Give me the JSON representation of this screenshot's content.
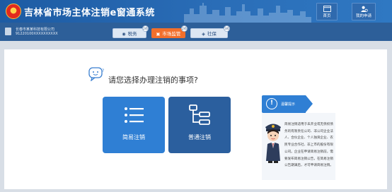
{
  "header": {
    "title": "吉林省市场主体注销e窗通系统",
    "buttons": [
      {
        "label": "首页",
        "icon": "home-icon"
      },
      {
        "label": "我的申请",
        "icon": "my-application-icon"
      }
    ]
  },
  "subbar": {
    "user_line1": "长春市某某科技有限公司",
    "user_line2": "91220100XXXXXXXXXX",
    "tabs": [
      {
        "label": "税务",
        "badge": "2/6",
        "icon": "tax-icon"
      },
      {
        "label": "市场监管",
        "badge": "2/6",
        "icon": "market-icon",
        "active": true
      },
      {
        "label": "社保",
        "badge": "3/6",
        "icon": "social-security-icon"
      }
    ]
  },
  "main": {
    "question": "请您选择办理注销的事项?",
    "cards": [
      {
        "label": "简易注销",
        "icon": "list-icon"
      },
      {
        "label": "普通注销",
        "icon": "tree-structure-icon"
      }
    ]
  },
  "notice": {
    "title": "温馨提示",
    "text": "简易注销适用于未开业或无债权债务的有限责任公司、非公司企业法人、合伙企业、个人独资企业、农民专业合作社、非上市的股份有限公司。企业在申请简易注销前，需要发布简易注销公告，在简易注销公告期满后，才可申请简易注销。"
  },
  "colors": {
    "header": "#2a6db7",
    "subbar": "#2d5f99",
    "active_tab": "#f26f2b",
    "card_simple": "#2f7fd4",
    "card_normal": "#2b5f9e"
  }
}
